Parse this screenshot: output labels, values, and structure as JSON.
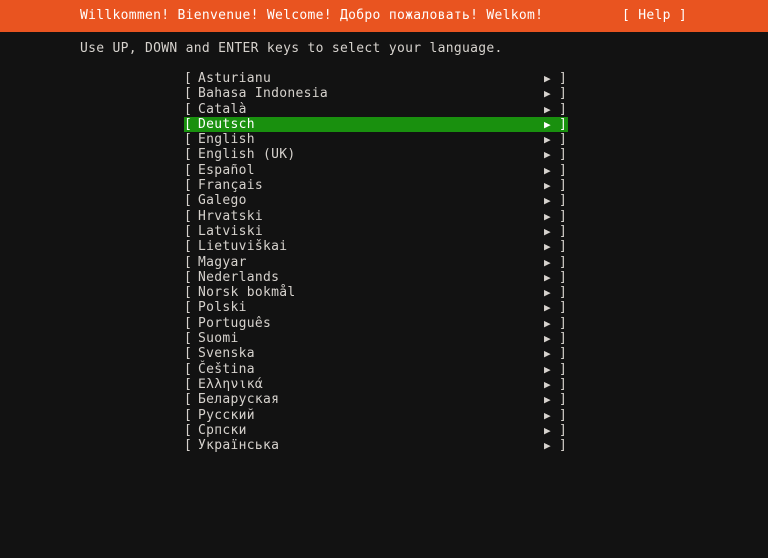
{
  "header": {
    "title": "Willkommen! Bienvenue! Welcome! Добро пожаловать! Welkom!",
    "help_label": "[ Help ]",
    "background_color": "#e95420",
    "text_color": "#ffffff"
  },
  "instruction": {
    "text": "Use UP, DOWN and ENTER keys to select your language."
  },
  "theme": {
    "background_color": "#121212",
    "foreground_color": "#d6d2cd",
    "selection_background_color": "#19900e",
    "selection_foreground_color": "#ffffff"
  },
  "language_list": {
    "bracket_open": "[",
    "bracket_close": "]",
    "arrow_glyph": "▶",
    "selected_index": 3,
    "items": [
      {
        "label": "Asturianu"
      },
      {
        "label": "Bahasa Indonesia"
      },
      {
        "label": "Català"
      },
      {
        "label": "Deutsch"
      },
      {
        "label": "English"
      },
      {
        "label": "English (UK)"
      },
      {
        "label": "Español"
      },
      {
        "label": "Français"
      },
      {
        "label": "Galego"
      },
      {
        "label": "Hrvatski"
      },
      {
        "label": "Latviski"
      },
      {
        "label": "Lietuviškai"
      },
      {
        "label": "Magyar"
      },
      {
        "label": "Nederlands"
      },
      {
        "label": "Norsk bokmål"
      },
      {
        "label": "Polski"
      },
      {
        "label": "Português"
      },
      {
        "label": "Suomi"
      },
      {
        "label": "Svenska"
      },
      {
        "label": "Čeština"
      },
      {
        "label": "Ελληνικά"
      },
      {
        "label": "Беларуская"
      },
      {
        "label": "Русский"
      },
      {
        "label": "Српски"
      },
      {
        "label": "Українська"
      }
    ]
  }
}
